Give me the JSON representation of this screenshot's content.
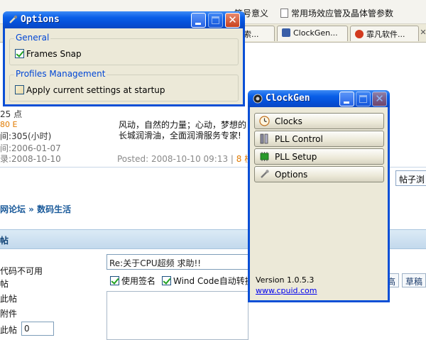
{
  "browser": {
    "top_items": [
      "符号意义",
      "常用场效应管及晶体管参数"
    ],
    "tabs": [
      {
        "label": "搜索..."
      },
      {
        "label": "ClockGen..."
      },
      {
        "label": "霏凡软件..."
      }
    ]
  },
  "forum": {
    "stats": [
      "25 点",
      "80 E",
      "间:305(小时)",
      "间:2006-01-07",
      "录:2008-10-10"
    ],
    "post_lines": [
      "风动，自然的力量；心动，梦想的",
      "长城润滑油，全面润滑服务专家!"
    ],
    "posted_label": "Posted: 2008-10-10 09:13 |",
    "floor_label": "8 楼",
    "view_button": "帖子浏",
    "breadcrumb": "网论坛 » 数码生活",
    "reply_title": "帖",
    "form_labels": [
      "代码不可用",
      "帖",
      "此帖",
      "附件",
      "此帖"
    ],
    "floor_input": "0",
    "subject": "Re:关于CPU超频 求助!!",
    "use_signature": "使用签名",
    "wind_code": "Wind Code自动转换",
    "btn_high": "高",
    "btn_draft": "草稿"
  },
  "options_window": {
    "title": "Options",
    "general_label": "General",
    "frames_snap": "Frames Snap",
    "frames_snap_checked": true,
    "profiles_label": "Profiles Management",
    "apply_startup": "Apply current settings at startup",
    "apply_startup_checked": false
  },
  "clockgen_window": {
    "title": "ClockGen",
    "buttons": [
      "Clocks",
      "PLL Control",
      "PLL Setup",
      "Options"
    ],
    "version": "Version 1.0.5.3",
    "website": "www.cpuid.com"
  },
  "colors": {
    "xp_title_blue": "#0a5fe8",
    "group_label_blue": "#0046d5",
    "close_red": "#c8411d",
    "window_face": "#ece9d8"
  }
}
